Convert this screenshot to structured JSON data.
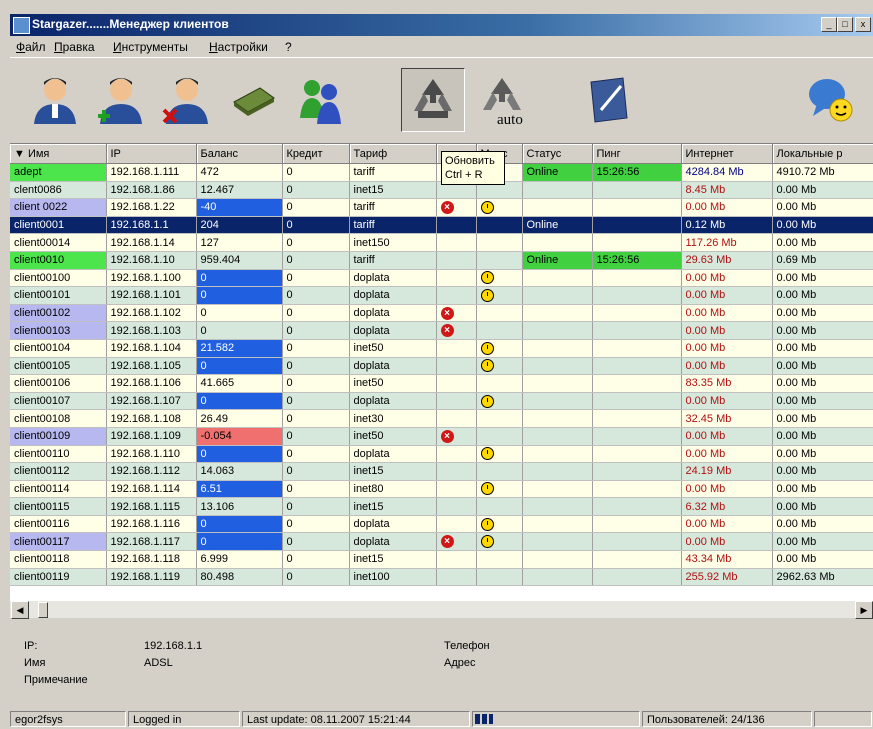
{
  "window": {
    "title": "Stargazer.......Менеджер клиентов",
    "minimize_label": "_",
    "restore_label": "□",
    "close_label": "x"
  },
  "menu": [
    "Файл",
    "Правка",
    "Инструменты",
    "Настройки",
    "?"
  ],
  "toolbar": {
    "buttons": [
      {
        "name": "user-icon"
      },
      {
        "name": "add-user-icon"
      },
      {
        "name": "delete-user-icon"
      },
      {
        "name": "money-icon"
      },
      {
        "name": "users-group-icon"
      },
      {
        "name": "refresh-icon"
      },
      {
        "name": "auto-refresh-icon",
        "label": "auto"
      },
      {
        "name": "edit-icon"
      },
      {
        "name": "chat-icon"
      }
    ]
  },
  "tooltip": {
    "line1": "Обновить",
    "line2": "Ctrl + R"
  },
  "table": {
    "columns": [
      "Имя",
      "IP",
      "Баланс",
      "Кредит",
      "Тариф",
      "",
      "Морс",
      "Статус",
      "Пинг",
      "Интернет",
      "Локальные р"
    ],
    "rows": [
      {
        "name": "adept",
        "ip": "192.168.1.111",
        "balance": "472",
        "credit": "0",
        "tariff": "tariff",
        "x": false,
        "clock": false,
        "status": "Online",
        "ping": "15:26:56",
        "internet": "4284.84 Mb",
        "local": "4910.72 Mb",
        "name_hl": "green",
        "bal_hl": "",
        "inet_blue": true
      },
      {
        "name": "clent0086",
        "ip": "192.168.1.86",
        "balance": "12.467",
        "credit": "0",
        "tariff": "inet15",
        "x": false,
        "clock": false,
        "status": "",
        "ping": "",
        "internet": "8.45 Mb",
        "local": "0.00 Mb",
        "name_hl": "",
        "bal_hl": ""
      },
      {
        "name": "client 0022",
        "ip": "192.168.1.22",
        "balance": "-40",
        "credit": "0",
        "tariff": "tariff",
        "x": true,
        "clock": true,
        "status": "",
        "ping": "",
        "internet": "0.00 Mb",
        "local": "0.00 Mb",
        "name_hl": "violet",
        "bal_hl": "blue"
      },
      {
        "name": "client0001",
        "ip": "192.168.1.1",
        "balance": "204",
        "credit": "0",
        "tariff": "tariff",
        "x": false,
        "clock": false,
        "status": "Online",
        "ping": "",
        "internet": "0.12 Mb",
        "local": "0.00 Mb",
        "name_hl": "",
        "bal_hl": "",
        "selected": true
      },
      {
        "name": "client00014",
        "ip": "192.168.1.14",
        "balance": "127",
        "credit": "0",
        "tariff": "inet150",
        "x": false,
        "clock": false,
        "status": "",
        "ping": "",
        "internet": "117.26 Mb",
        "local": "0.00 Mb",
        "name_hl": "",
        "bal_hl": ""
      },
      {
        "name": "client0010",
        "ip": "192.168.1.10",
        "balance": "959.404",
        "credit": "0",
        "tariff": "tariff",
        "x": false,
        "clock": false,
        "status": "Online",
        "ping": "15:26:56",
        "internet": "29.63 Mb",
        "local": "0.69 Mb",
        "name_hl": "green",
        "bal_hl": ""
      },
      {
        "name": "client00100",
        "ip": "192.168.1.100",
        "balance": "0",
        "credit": "0",
        "tariff": "doplata",
        "x": false,
        "clock": true,
        "status": "",
        "ping": "",
        "internet": "0.00 Mb",
        "local": "0.00 Mb",
        "name_hl": "",
        "bal_hl": "blue"
      },
      {
        "name": "client00101",
        "ip": "192.168.1.101",
        "balance": "0",
        "credit": "0",
        "tariff": "doplata",
        "x": false,
        "clock": true,
        "status": "",
        "ping": "",
        "internet": "0.00 Mb",
        "local": "0.00 Mb",
        "name_hl": "",
        "bal_hl": "blue"
      },
      {
        "name": "client00102",
        "ip": "192.168.1.102",
        "balance": "0",
        "credit": "0",
        "tariff": "doplata",
        "x": true,
        "clock": false,
        "status": "",
        "ping": "",
        "internet": "0.00 Mb",
        "local": "0.00 Mb",
        "name_hl": "violet",
        "bal_hl": ""
      },
      {
        "name": "client00103",
        "ip": "192.168.1.103",
        "balance": "0",
        "credit": "0",
        "tariff": "doplata",
        "x": true,
        "clock": false,
        "status": "",
        "ping": "",
        "internet": "0.00 Mb",
        "local": "0.00 Mb",
        "name_hl": "violet",
        "bal_hl": ""
      },
      {
        "name": "client00104",
        "ip": "192.168.1.104",
        "balance": "21.582",
        "credit": "0",
        "tariff": "inet50",
        "x": false,
        "clock": true,
        "status": "",
        "ping": "",
        "internet": "0.00 Mb",
        "local": "0.00 Mb",
        "name_hl": "",
        "bal_hl": "blue"
      },
      {
        "name": "client00105",
        "ip": "192.168.1.105",
        "balance": "0",
        "credit": "0",
        "tariff": "doplata",
        "x": false,
        "clock": true,
        "status": "",
        "ping": "",
        "internet": "0.00 Mb",
        "local": "0.00 Mb",
        "name_hl": "",
        "bal_hl": "blue"
      },
      {
        "name": "client00106",
        "ip": "192.168.1.106",
        "balance": "41.665",
        "credit": "0",
        "tariff": "inet50",
        "x": false,
        "clock": false,
        "status": "",
        "ping": "",
        "internet": "83.35 Mb",
        "local": "0.00 Mb",
        "name_hl": "",
        "bal_hl": ""
      },
      {
        "name": "client00107",
        "ip": "192.168.1.107",
        "balance": "0",
        "credit": "0",
        "tariff": "doplata",
        "x": false,
        "clock": true,
        "status": "",
        "ping": "",
        "internet": "0.00 Mb",
        "local": "0.00 Mb",
        "name_hl": "",
        "bal_hl": "blue"
      },
      {
        "name": "client00108",
        "ip": "192.168.1.108",
        "balance": "26.49",
        "credit": "0",
        "tariff": "inet30",
        "x": false,
        "clock": false,
        "status": "",
        "ping": "",
        "internet": "32.45 Mb",
        "local": "0.00 Mb",
        "name_hl": "",
        "bal_hl": ""
      },
      {
        "name": "client00109",
        "ip": "192.168.1.109",
        "balance": "-0.054",
        "credit": "0",
        "tariff": "inet50",
        "x": true,
        "clock": false,
        "status": "",
        "ping": "",
        "internet": "0.00 Mb",
        "local": "0.00 Mb",
        "name_hl": "violet",
        "bal_hl": "red"
      },
      {
        "name": "client00110",
        "ip": "192.168.1.110",
        "balance": "0",
        "credit": "0",
        "tariff": "doplata",
        "x": false,
        "clock": true,
        "status": "",
        "ping": "",
        "internet": "0.00 Mb",
        "local": "0.00 Mb",
        "name_hl": "",
        "bal_hl": "blue"
      },
      {
        "name": "client00112",
        "ip": "192.168.1.112",
        "balance": "14.063",
        "credit": "0",
        "tariff": "inet15",
        "x": false,
        "clock": false,
        "status": "",
        "ping": "",
        "internet": "24.19 Mb",
        "local": "0.00 Mb",
        "name_hl": "",
        "bal_hl": ""
      },
      {
        "name": "client00114",
        "ip": "192.168.1.114",
        "balance": "6.51",
        "credit": "0",
        "tariff": "inet80",
        "x": false,
        "clock": true,
        "status": "",
        "ping": "",
        "internet": "0.00 Mb",
        "local": "0.00 Mb",
        "name_hl": "",
        "bal_hl": "blue"
      },
      {
        "name": "client00115",
        "ip": "192.168.1.115",
        "balance": "13.106",
        "credit": "0",
        "tariff": "inet15",
        "x": false,
        "clock": false,
        "status": "",
        "ping": "",
        "internet": "6.32 Mb",
        "local": "0.00 Mb",
        "name_hl": "",
        "bal_hl": ""
      },
      {
        "name": "client00116",
        "ip": "192.168.1.116",
        "balance": "0",
        "credit": "0",
        "tariff": "doplata",
        "x": false,
        "clock": true,
        "status": "",
        "ping": "",
        "internet": "0.00 Mb",
        "local": "0.00 Mb",
        "name_hl": "",
        "bal_hl": "blue"
      },
      {
        "name": "client00117",
        "ip": "192.168.1.117",
        "balance": "0",
        "credit": "0",
        "tariff": "doplata",
        "x": true,
        "clock": true,
        "status": "",
        "ping": "",
        "internet": "0.00 Mb",
        "local": "0.00 Mb",
        "name_hl": "violet",
        "bal_hl": "blue"
      },
      {
        "name": "client00118",
        "ip": "192.168.1.118",
        "balance": "6.999",
        "credit": "0",
        "tariff": "inet15",
        "x": false,
        "clock": false,
        "status": "",
        "ping": "",
        "internet": "43.34 Mb",
        "local": "0.00 Mb",
        "name_hl": "",
        "bal_hl": ""
      },
      {
        "name": "client00119",
        "ip": "192.168.1.119",
        "balance": "80.498",
        "credit": "0",
        "tariff": "inet100",
        "x": false,
        "clock": false,
        "status": "",
        "ping": "",
        "internet": "255.92 Mb",
        "local": "2962.63 Mb",
        "name_hl": "",
        "bal_hl": ""
      }
    ]
  },
  "details": {
    "ip_label": "IP:",
    "ip_value": "192.168.1.1",
    "name_label": "Имя",
    "name_value": "ADSL",
    "note_label": "Примечание",
    "phone_label": "Телефон",
    "address_label": "Адрес"
  },
  "statusbar": {
    "user": "egor2fsys",
    "state": "Logged in",
    "last_update": "Last update: 08.11.2007 15:21:44",
    "users": "Пользователей: 24/136"
  }
}
